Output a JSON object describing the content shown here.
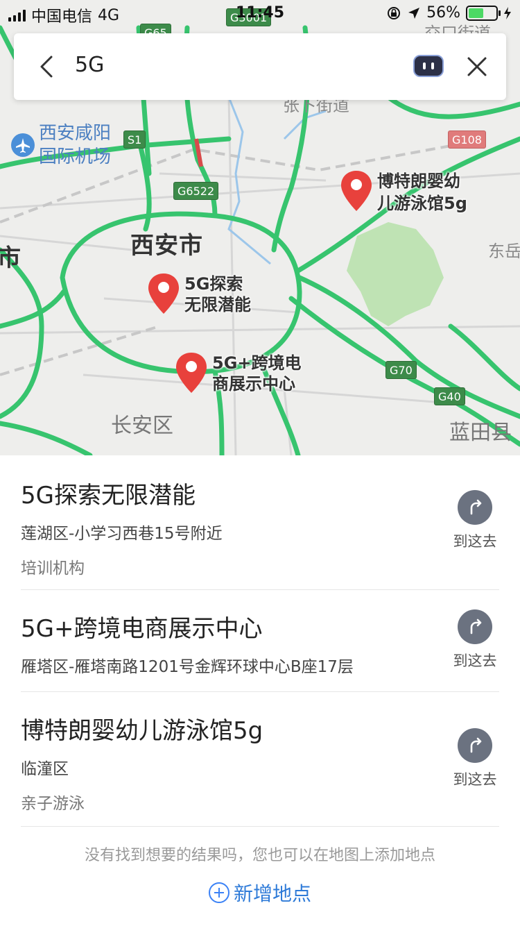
{
  "status_bar": {
    "carrier": "中国电信",
    "network": "4G",
    "time": "11:45",
    "battery": "56%",
    "battery_level": 0.56
  },
  "search": {
    "query": "5G"
  },
  "map": {
    "top_labels": {
      "partial_top_right": "交口街道",
      "partial_mid": "张卜街道"
    },
    "airport": [
      "西安咸阳",
      "国际机场"
    ],
    "city": "西安市",
    "city_left_partial": "市",
    "east_label": "东岳",
    "district_changan": "长安区",
    "district_lantian": "蓝田县",
    "shields": {
      "g65": "G65",
      "g3001": "G3001",
      "s1": "S1",
      "g6522": "G6522",
      "g108": "G108",
      "g70": "G70",
      "g40": "G40"
    },
    "pins": [
      {
        "label1": "5G探索",
        "label2": "无限潜能"
      },
      {
        "label1": "5G+跨境电",
        "label2": "商展示中心"
      },
      {
        "label1": "博特朗婴幼",
        "label2": "儿游泳馆5g"
      }
    ]
  },
  "results": [
    {
      "title": "5G探索无限潜能",
      "address": "莲湖区-小学习西巷15号附近",
      "category": "培训机构",
      "action": "到这去"
    },
    {
      "title": "5G+跨境电商展示中心",
      "address": "雁塔区-雁塔南路1201号金辉环球中心B座17层",
      "category": "",
      "action": "到这去"
    },
    {
      "title": "博特朗婴幼儿游泳馆5g",
      "address": "临潼区",
      "category": "亲子游泳",
      "action": "到这去"
    }
  ],
  "footer": {
    "hint": "没有找到想要的结果吗，您也可以在地图上添加地点",
    "add_place": "新增地点"
  },
  "colors": {
    "road": "#37c46e",
    "pin": "#e8413c",
    "link": "#2f7bd8"
  }
}
